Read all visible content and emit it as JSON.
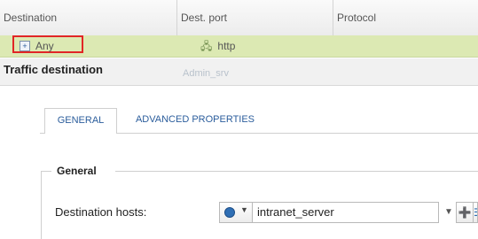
{
  "grid": {
    "columns": [
      "Destination",
      "Dest. port",
      "Protocol"
    ],
    "row": {
      "destination": "Any",
      "dest_port": "http"
    }
  },
  "panel": {
    "title": "Traffic destination",
    "ghost_text": "Admin_srv"
  },
  "tabs": [
    {
      "label": "GENERAL",
      "active": true
    },
    {
      "label": "ADVANCED PROPERTIES",
      "active": false
    }
  ],
  "section": {
    "legend": "General",
    "destination_hosts_label": "Destination hosts:",
    "destination_hosts_value": "intranet_server"
  },
  "icons": {
    "expander": "plus-box-icon",
    "port": "port-icon",
    "host_type": "host-globe-icon",
    "add": "add-object-icon",
    "list": "list-icon"
  },
  "colors": {
    "selected_row": "#dce9b3",
    "highlight": "#e12626",
    "link_blue": "#2b5d9c"
  }
}
